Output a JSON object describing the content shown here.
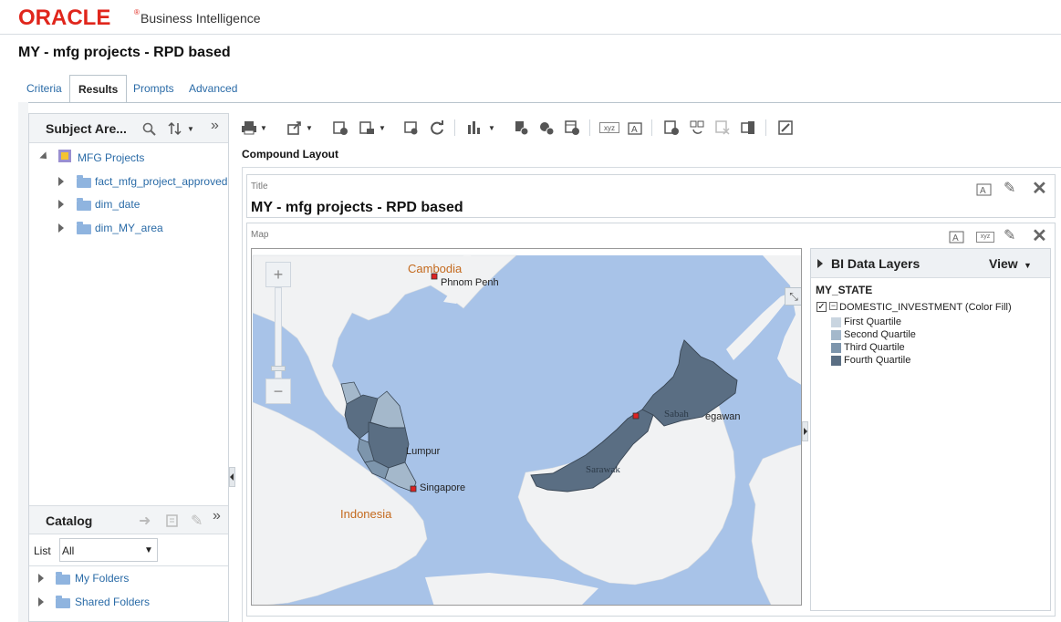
{
  "header": {
    "logo_brand": "ORACLE",
    "logo_product": "Business Intelligence"
  },
  "page": {
    "title": "MY - mfg projects - RPD based"
  },
  "tabs": [
    {
      "label": "Criteria"
    },
    {
      "label": "Results"
    },
    {
      "label": "Prompts"
    },
    {
      "label": "Advanced"
    }
  ],
  "subject_areas": {
    "title": "Subject Are...",
    "root": "MFG Projects",
    "items": [
      {
        "label": "fact_mfg_project_approved"
      },
      {
        "label": "dim_date"
      },
      {
        "label": "dim_MY_area"
      }
    ]
  },
  "catalog": {
    "title": "Catalog",
    "list_label": "List",
    "list_value": "All",
    "folders": [
      {
        "label": "My Folders"
      },
      {
        "label": "Shared Folders"
      }
    ]
  },
  "layout": {
    "compound_label": "Compound Layout",
    "title_view_caption": "Title",
    "title_view_text": "MY - mfg projects - RPD based",
    "map_view_caption": "Map"
  },
  "map": {
    "labels": {
      "cambodia": "Cambodia",
      "phnom_penh": "Phnom Penh",
      "indonesia": "Indonesia",
      "singapore": "Singapore",
      "lumpur": "Lumpur",
      "sabah": "Sabah",
      "begawan": "egawan",
      "sarawak": "Sarawak"
    },
    "zoom_in": "+",
    "zoom_out": "−"
  },
  "legend": {
    "title": "BI Data Layers",
    "view_label": "View",
    "layer": "MY_STATE",
    "metric": "DOMESTIC_INVESTMENT (Color Fill)",
    "metric_checked": true,
    "quartiles": [
      {
        "label": "First Quartile",
        "color": "#c9d5e0"
      },
      {
        "label": "Second Quartile",
        "color": "#a4b8cb"
      },
      {
        "label": "Third Quartile",
        "color": "#7d95ac"
      },
      {
        "label": "Fourth Quartile",
        "color": "#5a6e83"
      }
    ]
  },
  "colors": {
    "oracle_red": "#e0261c",
    "link_blue": "#2a6ba7",
    "sea": "#a8c3e8",
    "land": "#f1f2f3"
  }
}
